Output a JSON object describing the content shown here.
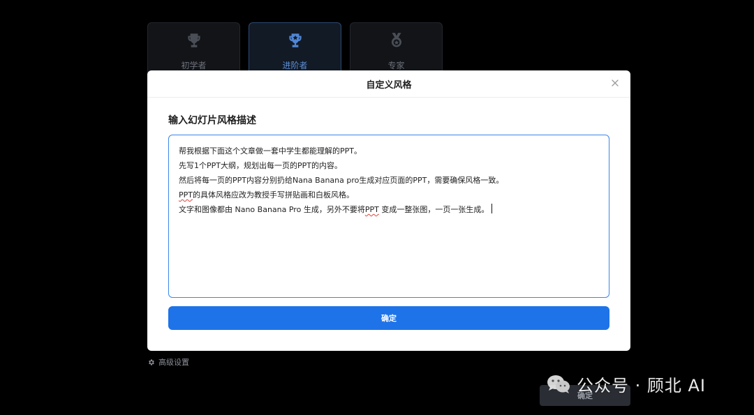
{
  "levels": [
    {
      "label": "初学者",
      "icon": "trophy-icon",
      "selected": false
    },
    {
      "label": "进阶者",
      "icon": "trophy-star-icon",
      "selected": true
    },
    {
      "label": "专家",
      "icon": "medal-icon",
      "selected": false
    }
  ],
  "modal": {
    "title": "自定义风格",
    "close_icon": "close-icon",
    "section_heading": "输入幻灯片风格描述",
    "textarea_lines": [
      "帮我根据下面这个文章做一套中学生都能理解的PPT。",
      "先写1个PPT大纲，规划出每一页的PPT的内容。",
      "然后将每一页的PPT内容分别扔给Nana Banana pro生成对应页面的PPT，需要确保风格一致。",
      "PPT的具体风格应改为教授手写拼贴画和白板风格。",
      "文字和图像都由 Nano Banana Pro 生成，另外不要将PPT 变成一整张图，一页一张生成。"
    ],
    "confirm_label": "确定"
  },
  "advanced_settings": {
    "label": "高级设置",
    "icon": "gear-icon"
  },
  "bottom_confirm_label": "确定",
  "watermark": {
    "text": "公众号 · 顾北 AI",
    "icon": "wechat-icon"
  },
  "colors": {
    "background": "#000000",
    "accent": "#1e73e8",
    "textarea_border": "#3a86e8"
  }
}
